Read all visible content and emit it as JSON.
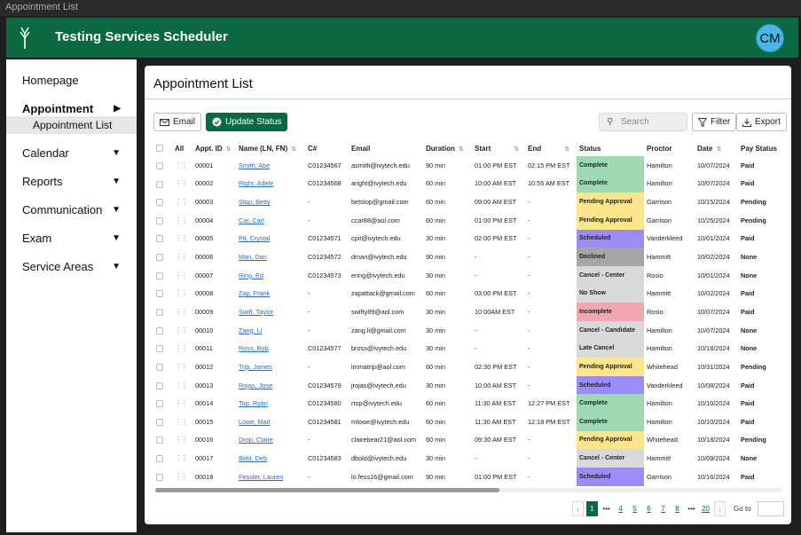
{
  "window": {
    "title": "Appointment List"
  },
  "header": {
    "app_title": "Testing Services Scheduler",
    "avatar_initials": "CM",
    "brand_color": "#0a6940"
  },
  "sidebar": {
    "items": [
      {
        "label": "Homepage",
        "arrow": ""
      },
      {
        "label": "Appointment",
        "arrow": "▶"
      },
      {
        "label": "Calendar",
        "arrow": "▼"
      },
      {
        "label": "Reports",
        "arrow": "▼"
      },
      {
        "label": "Communication",
        "arrow": "▼"
      },
      {
        "label": "Exam",
        "arrow": "▼"
      },
      {
        "label": "Service Areas",
        "arrow": "▼"
      }
    ],
    "sub_item": "Appointment List"
  },
  "main": {
    "page_title": "Appointment List",
    "toolbar": {
      "email_label": "Email",
      "update_status_label": "Update Status",
      "search_placeholder": "Search",
      "filter_label": "Filter",
      "export_label": "Export"
    },
    "columns": [
      "All",
      "Appt. ID",
      "Name (LN, FN)",
      "C#",
      "Email",
      "Duration",
      "Start",
      "End",
      "Status",
      "Proctor",
      "Date",
      "Pay Status"
    ],
    "status_colors": {
      "Complete": "#9fd9b3",
      "Pending Approval": "#fde58b",
      "Scheduled": "#9b8cf7",
      "Declined": "#a6a6a6",
      "Cancel - Center": "#d9d9d9",
      "No Show": "#d9d9d9",
      "Incomplete": "#f2a7ae",
      "Cancel - Candidate": "#d9d9d9",
      "Late Cancel": "#d9d9d9"
    },
    "rows": [
      {
        "id": "00001",
        "name": "Smith, Abe",
        "c": "C01234567",
        "email": "asmith@ivytech.edu",
        "dur": "90 min",
        "start": "01:00 PM EST",
        "end": "02:15 PM EST",
        "status": "Complete",
        "proctor": "Hamilton",
        "date": "10/07/2024",
        "pay": "Paid"
      },
      {
        "id": "00002",
        "name": "Right, Adele",
        "c": "C01234568",
        "email": "aright@ivytech.edu",
        "dur": "60 min",
        "start": "10:00 AM EST",
        "end": "10:55 AM EST",
        "status": "Complete",
        "proctor": "Hamilton",
        "date": "10/07/2024",
        "pay": "Paid"
      },
      {
        "id": "00003",
        "name": "Stop, Betty",
        "c": "-",
        "email": "betstop@gmail.com",
        "dur": "60 min",
        "start": "09:00 AM EST",
        "end": "-",
        "status": "Pending Approval",
        "proctor": "Garrison",
        "date": "10/15/2024",
        "pay": "Pending"
      },
      {
        "id": "00004",
        "name": "Car, Carl",
        "c": "-",
        "email": "ccar88@aol.com",
        "dur": "60 min",
        "start": "01:00 PM EST",
        "end": "-",
        "status": "Pending Approval",
        "proctor": "Garrison",
        "date": "10/25/2024",
        "pay": "Pending"
      },
      {
        "id": "00005",
        "name": "Pit, Crystal",
        "c": "C01234571",
        "email": "cpit@ivytech.edu",
        "dur": "30 min",
        "start": "02:00 PM EST",
        "end": "-",
        "status": "Scheduled",
        "proctor": "Vanderkleed",
        "date": "10/01/2024",
        "pay": "Paid"
      },
      {
        "id": "00006",
        "name": "Man, Dan",
        "c": "C01234572",
        "email": "dman@ivytech.edu",
        "dur": "90 min",
        "start": "-",
        "end": "-",
        "status": "Declined",
        "proctor": "Hammitt",
        "date": "10/02/2024",
        "pay": "None"
      },
      {
        "id": "00007",
        "name": "Ring, Ed",
        "c": "C01234573",
        "email": "ering@ivytech.edu",
        "dur": "30 min",
        "start": "-",
        "end": "-",
        "status": "Cancel - Center",
        "proctor": "Rosio",
        "date": "10/01/2024",
        "pay": "None"
      },
      {
        "id": "00008",
        "name": "Zap, Frank",
        "c": "-",
        "email": "zapattack@gmail.com",
        "dur": "60 min",
        "start": "03:00 PM EST",
        "end": "-",
        "status": "No Show",
        "proctor": "Hammitt",
        "date": "10/02/2024",
        "pay": "Paid"
      },
      {
        "id": "00009",
        "name": "Swift, Taylor",
        "c": "-",
        "email": "swifty89@aol.com",
        "dur": "30 min",
        "start": "10:00AM EST",
        "end": "-",
        "status": "Incomplete",
        "proctor": "Rosio",
        "date": "10/07/2024",
        "pay": "Paid"
      },
      {
        "id": "00010",
        "name": "Zang, Li",
        "c": "-",
        "email": "zang.li@gmail.com",
        "dur": "30 min",
        "start": "-",
        "end": "-",
        "status": "Cancel - Candidate",
        "proctor": "Hamilton",
        "date": "10/07/2024",
        "pay": "None"
      },
      {
        "id": "00011",
        "name": "Ross, Bob",
        "c": "C01234577",
        "email": "bross@ivytech.edu",
        "dur": "30 min",
        "start": "-",
        "end": "-",
        "status": "Late Cancel",
        "proctor": "Hamilton",
        "date": "10/18/2024",
        "pay": "None"
      },
      {
        "id": "00012",
        "name": "Trip, James",
        "c": "-",
        "email": "lmmatrip@aol.com",
        "dur": "60 min",
        "start": "02:30 PM EST",
        "end": "-",
        "status": "Pending Approval",
        "proctor": "Whitehead",
        "date": "10/31/2024",
        "pay": "Pending"
      },
      {
        "id": "00013",
        "name": "Rojas, Jose",
        "c": "C01234579",
        "email": "jrojas@ivytech.edu",
        "dur": "30 min",
        "start": "10:00 AM EST",
        "end": "-",
        "status": "Scheduled",
        "proctor": "Vanderkleed",
        "date": "10/08/2024",
        "pay": "Paid"
      },
      {
        "id": "00014",
        "name": "Top, Ryan",
        "c": "C01234580",
        "email": "rtop@ivytech.edu",
        "dur": "60 min",
        "start": "11:30 AM EST",
        "end": "12:27 PM EST",
        "status": "Complete",
        "proctor": "Hamilton",
        "date": "10/10/2024",
        "pay": "Paid"
      },
      {
        "id": "00015",
        "name": "Lowe, Matt",
        "c": "C01234581",
        "email": "mlowe@ivytech.edu",
        "dur": "60 min",
        "start": "11:30 AM EST",
        "end": "12:18 PM EST",
        "status": "Complete",
        "proctor": "Hamilton",
        "date": "10/10/2024",
        "pay": "Paid"
      },
      {
        "id": "00016",
        "name": "Drop, Claire",
        "c": "-",
        "email": "clairebear21@aol.com",
        "dur": "60 min",
        "start": "09:30 AM EST",
        "end": "-",
        "status": "Pending Approval",
        "proctor": "Whitehead",
        "date": "10/18/2024",
        "pay": "Pending"
      },
      {
        "id": "00017",
        "name": "Bold, Deb",
        "c": "C01234583",
        "email": "dbold@ivytech.edu",
        "dur": "30 min",
        "start": "-",
        "end": "-",
        "status": "Cancel - Center",
        "proctor": "Hammitt",
        "date": "10/09/2024",
        "pay": "None"
      },
      {
        "id": "00018",
        "name": "Fessler, Lauren",
        "c": "-",
        "email": "lo.fess16@gmail.com",
        "dur": "90 min",
        "start": "01:00 PM EST",
        "end": "-",
        "status": "Scheduled",
        "proctor": "Garrison",
        "date": "10/16/2024",
        "pay": "Paid"
      }
    ],
    "pagination": {
      "prev": "‹",
      "next": "›",
      "pages": [
        "1",
        "•••",
        "4",
        "5",
        "6",
        "7",
        "8",
        "•••",
        "20"
      ],
      "active": "1",
      "goto_label": "Go to"
    }
  }
}
